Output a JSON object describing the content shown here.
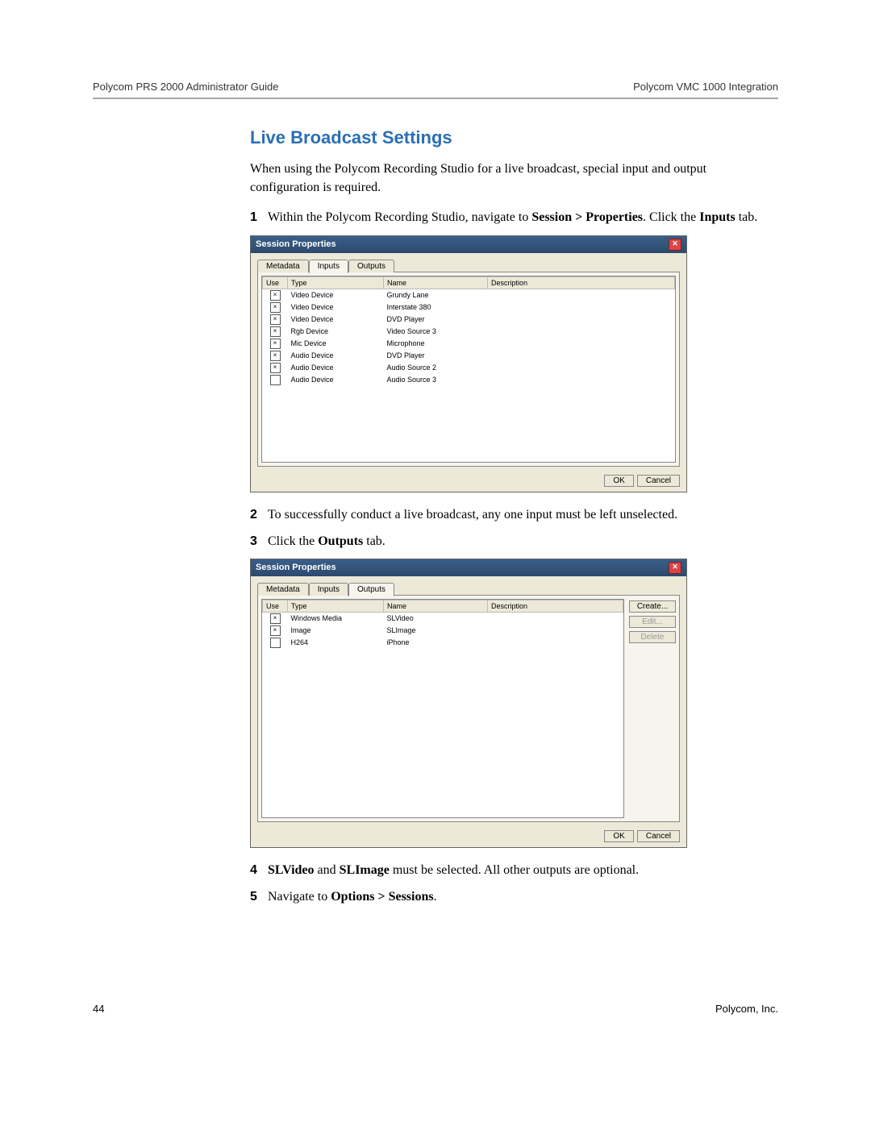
{
  "header": {
    "left": "Polycom PRS 2000 Administrator Guide",
    "right": "Polycom VMC 1000 Integration"
  },
  "section_heading": "Live Broadcast Settings",
  "intro": "When using the Polycom Recording Studio for a live broadcast, special input and output configuration is required.",
  "step1_pre": "Within the Polycom Recording Studio, navigate to ",
  "step1_bold1": "Session > Properties",
  "step1_mid": ". Click the ",
  "step1_bold2": "Inputs",
  "step1_post": " tab.",
  "step2": "To successfully conduct a live broadcast, any one input must be left unselected.",
  "step3_pre": "Click the ",
  "step3_bold": "Outputs",
  "step3_post": " tab.",
  "step4_bold1": "SLVideo",
  "step4_mid1": " and ",
  "step4_bold2": "SLImage",
  "step4_post": " must be selected. All other outputs are optional.",
  "step5_pre": "Navigate to ",
  "step5_bold": "Options > Sessions",
  "step5_post": ".",
  "dialog1": {
    "title": "Session Properties",
    "tabs": [
      "Metadata",
      "Inputs",
      "Outputs"
    ],
    "active_tab": 1,
    "columns": [
      "Use",
      "Type",
      "Name",
      "Description"
    ],
    "rows": [
      {
        "use": true,
        "type": "Video Device",
        "name": "Grundy Lane",
        "desc": ""
      },
      {
        "use": true,
        "type": "Video Device",
        "name": "Interstate 380",
        "desc": ""
      },
      {
        "use": true,
        "type": "Video Device",
        "name": "DVD Player",
        "desc": ""
      },
      {
        "use": true,
        "type": "Rgb Device",
        "name": "Video Source 3",
        "desc": ""
      },
      {
        "use": true,
        "type": "Mic Device",
        "name": "Microphone",
        "desc": ""
      },
      {
        "use": true,
        "type": "Audio Device",
        "name": "DVD Player",
        "desc": ""
      },
      {
        "use": true,
        "type": "Audio Device",
        "name": "Audio Source 2",
        "desc": ""
      },
      {
        "use": false,
        "type": "Audio Device",
        "name": "Audio Source 3",
        "desc": ""
      }
    ],
    "ok": "OK",
    "cancel": "Cancel"
  },
  "dialog2": {
    "title": "Session Properties",
    "tabs": [
      "Metadata",
      "Inputs",
      "Outputs"
    ],
    "active_tab": 2,
    "columns": [
      "Use",
      "Type",
      "Name",
      "Description"
    ],
    "rows": [
      {
        "use": true,
        "type": "Windows Media",
        "name": "SLVideo",
        "desc": ""
      },
      {
        "use": true,
        "type": "Image",
        "name": "SLImage",
        "desc": ""
      },
      {
        "use": false,
        "type": "H264",
        "name": "iPhone",
        "desc": ""
      }
    ],
    "create": "Create...",
    "edit": "Edit...",
    "delete": "Delete",
    "ok": "OK",
    "cancel": "Cancel"
  },
  "footer": {
    "page": "44",
    "org": "Polycom, Inc."
  },
  "nums": {
    "n1": "1",
    "n2": "2",
    "n3": "3",
    "n4": "4",
    "n5": "5"
  }
}
